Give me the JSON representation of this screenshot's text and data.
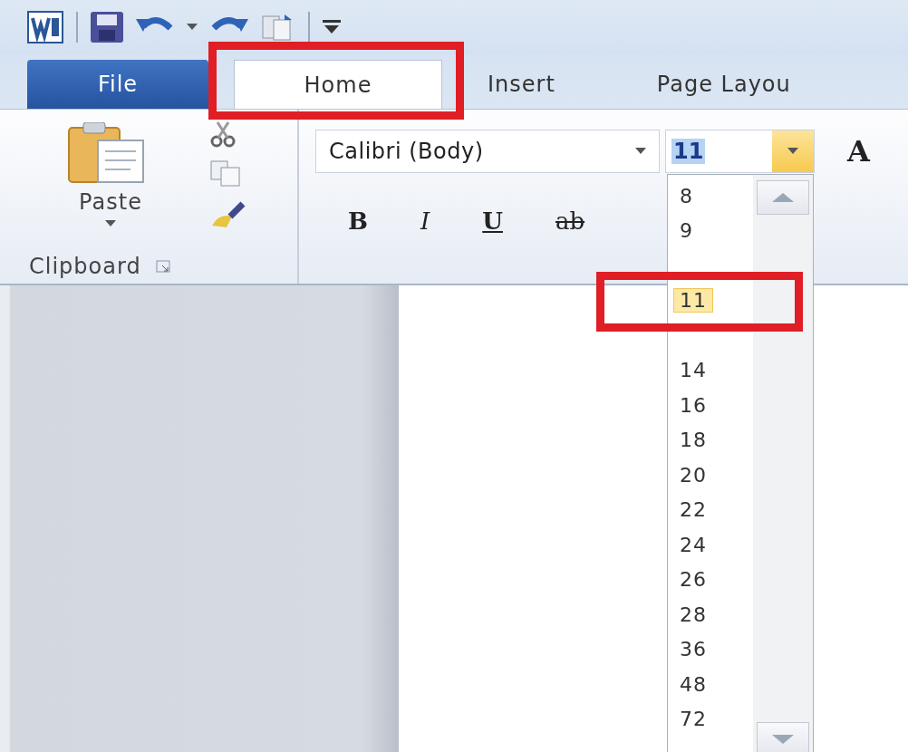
{
  "tabs": [
    {
      "label": "File",
      "kind": "file",
      "selected": false,
      "highlighted": false
    },
    {
      "label": "Home",
      "kind": "tab",
      "selected": true,
      "highlighted": true
    },
    {
      "label": "Insert",
      "kind": "tab",
      "selected": false,
      "highlighted": false
    },
    {
      "label": "Page Layou",
      "kind": "tab",
      "selected": false,
      "highlighted": false
    }
  ],
  "clipboard": {
    "paste_label": "Paste",
    "group_label": "Clipboard"
  },
  "font": {
    "name": "Calibri (Body)",
    "size": "11",
    "bold": "B",
    "italic": "I",
    "underline": "U",
    "strikethrough": "ab",
    "grow": "A"
  },
  "size_list": [
    {
      "label": "8",
      "selected": false,
      "highlighted": false
    },
    {
      "label": "9",
      "selected": false,
      "highlighted": false
    },
    {
      "label": "11",
      "selected": true,
      "highlighted": true
    },
    {
      "label": "14",
      "selected": false,
      "highlighted": false
    },
    {
      "label": "16",
      "selected": false,
      "highlighted": false
    },
    {
      "label": "18",
      "selected": false,
      "highlighted": false
    },
    {
      "label": "20",
      "selected": false,
      "highlighted": false
    },
    {
      "label": "22",
      "selected": false,
      "highlighted": false
    },
    {
      "label": "24",
      "selected": false,
      "highlighted": false
    },
    {
      "label": "26",
      "selected": false,
      "highlighted": false
    },
    {
      "label": "28",
      "selected": false,
      "highlighted": false
    },
    {
      "label": "36",
      "selected": false,
      "highlighted": false
    },
    {
      "label": "48",
      "selected": false,
      "highlighted": false
    },
    {
      "label": "72",
      "selected": false,
      "highlighted": false
    }
  ]
}
